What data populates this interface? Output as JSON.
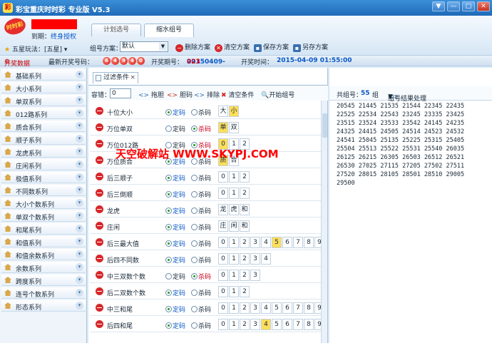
{
  "window": {
    "title": "彩宝重庆时时彩  专业版 V5.3",
    "controls": [
      "▼",
      "—",
      "□",
      "✕"
    ]
  },
  "header": {
    "brand": "时时彩",
    "expire_label": "到期：",
    "expire_value": "终身授权",
    "tabs": [
      {
        "label": "计划选号",
        "active": false
      },
      {
        "label": "缩水组号",
        "active": true
      }
    ],
    "mode_label": "五星玩法：",
    "mode_value": "[五星]",
    "scheme_label": "组号方案：",
    "scheme_value": "默认",
    "buttons": {
      "delete_scheme": "删除方案",
      "clear_scheme": "清空方案",
      "save_scheme": "保存方案",
      "save_as_scheme": "另存方案"
    }
  },
  "lottery": {
    "open_data": "开奖数据",
    "latest_label": "最新开奖号码：",
    "balls": [
      "6",
      "4",
      "9",
      "4",
      "0"
    ],
    "issue_label": "开奖期号：",
    "issue_prefix": "20150409-",
    "issue_suffix": "023",
    "time_label": "开奖时间：",
    "time_value": "2015-04-09 01:55:00"
  },
  "sidebar": {
    "items": [
      "基础系列",
      "大小系列",
      "单双系列",
      "012路系列",
      "质合系列",
      "顺子系列",
      "龙虎系列",
      "庄闲系列",
      "极值系列",
      "不同数系列",
      "大小个数系列",
      "单双个数系列",
      "和尾系列",
      "和值系列",
      "和值余数系列",
      "余数系列",
      "跨度系列",
      "连号个数系列",
      "形态系列"
    ]
  },
  "filter": {
    "tab_label": "过滤条件",
    "tab_close": "×",
    "tolerance_label": "容错：",
    "tolerance_value": "0",
    "toolbar": {
      "tuo_dan": "拖胆",
      "dan_ma": "胆码",
      "pai_chu": "排除",
      "clear_conditions": "清空条件",
      "start_group": "开始组号"
    },
    "radio_keep": "定码",
    "radio_kill": "杀码",
    "conditions": [
      {
        "name": "十位大小",
        "mode": "keep",
        "cells": [
          "大",
          "小"
        ],
        "highlight": [
          1
        ]
      },
      {
        "name": "万位单双",
        "mode": "kill",
        "cells": [
          "单",
          "双"
        ],
        "highlight": [
          0
        ]
      },
      {
        "name": "万位012路",
        "mode": "kill",
        "cells": [
          "0",
          "1",
          "2"
        ],
        "highlight": [
          0
        ]
      },
      {
        "name": "万位质合",
        "mode": "keep",
        "cells": [
          "质",
          "合"
        ],
        "highlight": [
          0
        ]
      },
      {
        "name": "后三顺子",
        "mode": "keep",
        "cells": [
          "0",
          "1",
          "2"
        ],
        "highlight": []
      },
      {
        "name": "后三倒顺",
        "mode": "keep",
        "cells": [
          "0",
          "1",
          "2"
        ],
        "highlight": []
      },
      {
        "name": "龙虎",
        "mode": "keep",
        "cells": [
          "龙",
          "虎",
          "和"
        ],
        "highlight": []
      },
      {
        "name": "庄闲",
        "mode": "keep",
        "cells": [
          "庄",
          "闲",
          "和"
        ],
        "highlight": []
      },
      {
        "name": "后三最大值",
        "mode": "keep",
        "cells": [
          "0",
          "1",
          "2",
          "3",
          "4",
          "5",
          "6",
          "7",
          "8",
          "9"
        ],
        "highlight": [
          5
        ]
      },
      {
        "name": "后四不同数",
        "mode": "keep",
        "cells": [
          "0",
          "1",
          "2",
          "3",
          "4"
        ],
        "highlight": []
      },
      {
        "name": "中三双数个数",
        "mode": "kill",
        "cells": [
          "0",
          "1",
          "2",
          "3"
        ],
        "highlight": []
      },
      {
        "name": "后二双数个数",
        "mode": "keep",
        "cells": [
          "0",
          "1",
          "2"
        ],
        "highlight": []
      },
      {
        "name": "中三和尾",
        "mode": "keep",
        "cells": [
          "0",
          "1",
          "2",
          "3",
          "4",
          "5",
          "6",
          "7",
          "8",
          "9"
        ],
        "highlight": []
      },
      {
        "name": "后四和尾",
        "mode": "keep",
        "cells": [
          "0",
          "1",
          "2",
          "3",
          "4",
          "5",
          "6",
          "7",
          "8",
          "9"
        ],
        "highlight": [
          4
        ]
      }
    ]
  },
  "watermark": "天空破解站 WWW.SKYPJ.COM",
  "results": {
    "total_label": "共组号：",
    "total_value": "55",
    "total_unit": "组",
    "process_label": "组号结果处理",
    "lines": [
      "20545 21445 21535 21544 22345 22435",
      "22525 22534 22543 23245 23335 23425",
      "23515 23524 23533 23542 24145 24235",
      "24325 24415 24505 24514 24523 24532",
      "24541 25045 25135 25225 25315 25405",
      "25504 25513 25522 25531 25540 26035",
      "26125 26215 26305 26503 26512 26521",
      "26530 27025 27115 27205 27502 27511",
      "27520 28015 28105 28501 28510 29005",
      "29500"
    ]
  }
}
